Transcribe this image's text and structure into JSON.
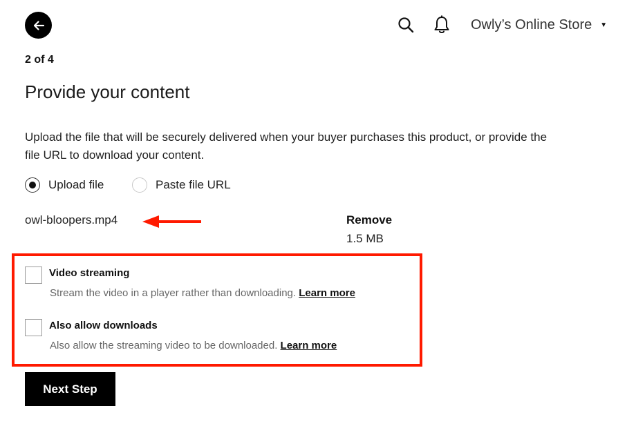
{
  "header": {
    "back_icon": "arrow-left-icon",
    "search_icon": "search-icon",
    "notifications_icon": "bell-icon",
    "store_name": "Owly’s Online Store",
    "store_menu_icon": "caret-down-icon"
  },
  "step": {
    "counter": "2 of 4",
    "title": "Provide your content",
    "description": "Upload the file that will be securely delivered when your buyer purchases this product, or provide the file URL to download your content."
  },
  "source_options": [
    {
      "label": "Upload file",
      "selected": true
    },
    {
      "label": "Paste file URL",
      "selected": false
    }
  ],
  "file": {
    "name": "owl-bloopers.mp4",
    "remove_label": "Remove",
    "size": "1.5 MB"
  },
  "options": {
    "video_streaming": {
      "title": "Video streaming",
      "help": "Stream the video in a player rather than downloading.",
      "link": "Learn more",
      "checked": false
    },
    "allow_downloads": {
      "title": "Also allow downloads",
      "help": "Also allow the streaming video to be downloaded.",
      "link": "Learn more",
      "checked": false
    }
  },
  "annotations": {
    "arrow_color": "#ff1a00",
    "highlight_color": "#ff1a00"
  },
  "actions": {
    "next_label": "Next Step"
  }
}
